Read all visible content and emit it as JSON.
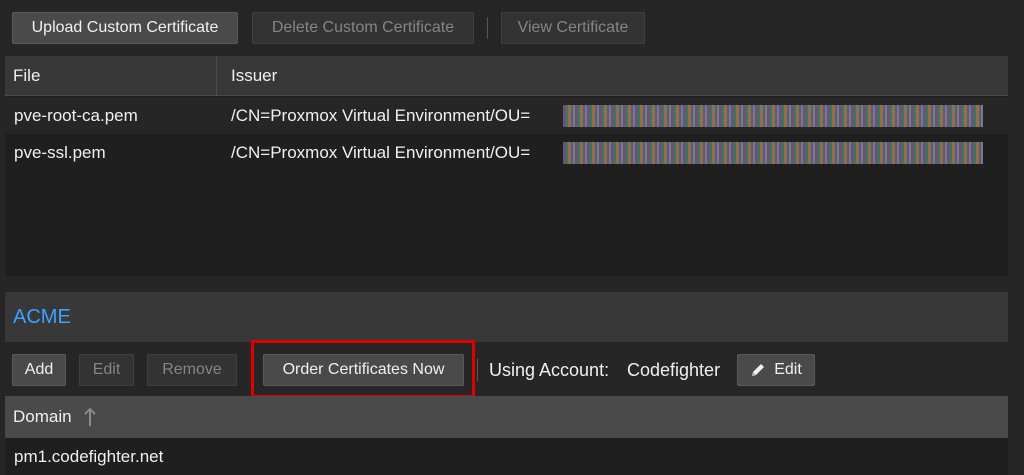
{
  "toolbar1": {
    "upload": "Upload Custom Certificate",
    "delete": "Delete Custom Certificate",
    "view": "View Certificate"
  },
  "cert_grid": {
    "headers": [
      "File",
      "Issuer"
    ],
    "rows": [
      {
        "file": "pve-root-ca.pem",
        "issuer": "/CN=Proxmox Virtual Environment/OU="
      },
      {
        "file": "pve-ssl.pem",
        "issuer": "/CN=Proxmox Virtual Environment/OU="
      }
    ]
  },
  "acme": {
    "title": "ACME",
    "add": "Add",
    "edit": "Edit",
    "remove": "Remove",
    "order": "Order Certificates Now",
    "account_label": "Using Account:",
    "account_value": "Codefighter",
    "account_edit": "Edit"
  },
  "domain_grid": {
    "header": "Domain",
    "sort_icon": "arrow-up-icon",
    "rows": [
      "pm1.codefighter.net"
    ]
  },
  "colors": {
    "accent_title": "#3ea0ff",
    "highlight_box": "#e00000"
  }
}
